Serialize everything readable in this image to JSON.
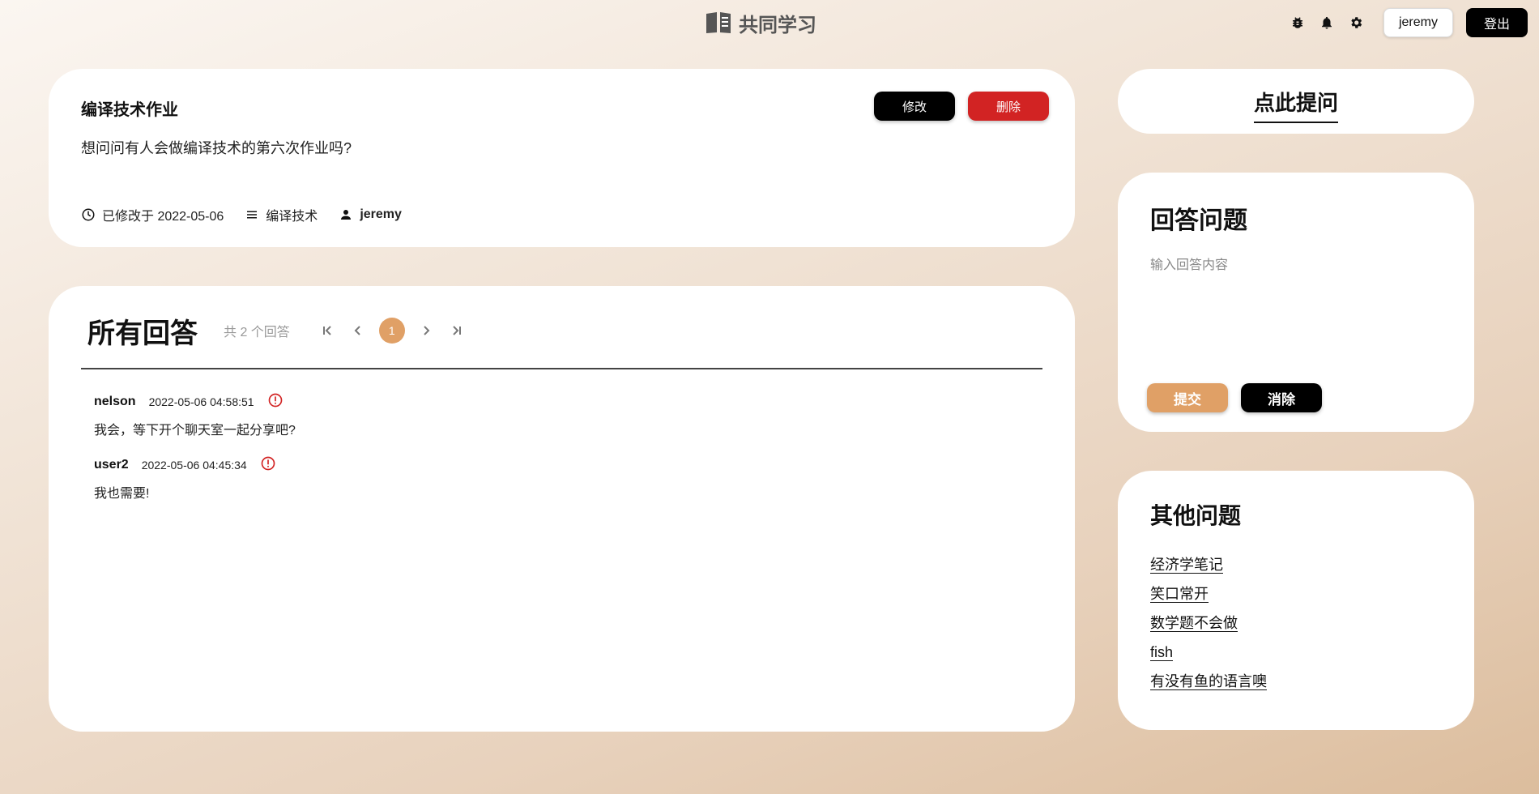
{
  "header": {
    "brand": "共同学习",
    "icons": [
      "bug-icon",
      "bell-icon",
      "gear-icon"
    ],
    "user_button": "jeremy",
    "logout_button": "登出"
  },
  "question": {
    "title": "编译技术作业",
    "body": "想问问有人会做编译技术的第六次作业吗?",
    "edit_button": "修改",
    "delete_button": "删除",
    "modified": "已修改于 2022-05-06",
    "category": "编译技术",
    "author": "jeremy"
  },
  "answers_section": {
    "title": "所有回答",
    "count": "共 2 个回答",
    "current_page": "1",
    "items": [
      {
        "user": "nelson",
        "time": "2022-05-06  04:58:51",
        "text": "我会，等下开个聊天室一起分享吧?"
      },
      {
        "user": "user2",
        "time": "2022-05-06  04:45:34",
        "text": "我也需要!"
      }
    ]
  },
  "ask": {
    "label": "点此提问"
  },
  "reply": {
    "title": "回答问题",
    "placeholder": "输入回答内容",
    "submit": "提交",
    "clear": "消除"
  },
  "other_questions": {
    "title": "其他问题",
    "items": [
      "经济学笔记",
      "笑口常开",
      "数学题不会做",
      "fish",
      "有没有鱼的语言噢"
    ]
  },
  "colors": {
    "accent": "#e0a066",
    "danger": "#d22323",
    "dark": "#000000"
  }
}
